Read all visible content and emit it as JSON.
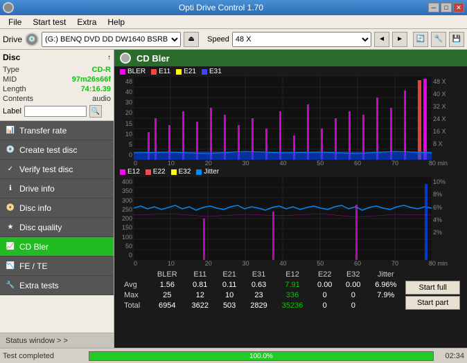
{
  "titlebar": {
    "title": "Opti Drive Control 1.70",
    "icon": "disc",
    "minimize": "─",
    "maximize": "□",
    "close": "✕"
  },
  "menubar": {
    "items": [
      "File",
      "Start test",
      "Extra",
      "Help"
    ]
  },
  "drivebar": {
    "label": "Drive",
    "drive_value": "(G:)  BENQ DVD DD DW1640 BSRB",
    "speed_label": "Speed",
    "speed_value": "48 X"
  },
  "disc": {
    "header": "Disc",
    "type_label": "Type",
    "type_value": "CD-R",
    "mid_label": "MID",
    "mid_value": "97m26s66f",
    "length_label": "Length",
    "length_value": "74:16.39",
    "contents_label": "Contents",
    "contents_value": "audio",
    "label_label": "Label",
    "label_value": ""
  },
  "nav": {
    "items": [
      {
        "id": "transfer-rate",
        "label": "Transfer rate",
        "icon": "📊"
      },
      {
        "id": "create-test-disc",
        "label": "Create test disc",
        "icon": "💿"
      },
      {
        "id": "verify-test-disc",
        "label": "Verify test disc",
        "icon": "✓"
      },
      {
        "id": "drive-info",
        "label": "Drive info",
        "icon": "ℹ"
      },
      {
        "id": "disc-info",
        "label": "Disc info",
        "icon": "📀"
      },
      {
        "id": "disc-quality",
        "label": "Disc quality",
        "icon": "★"
      },
      {
        "id": "cd-bler",
        "label": "CD Bler",
        "icon": "📈",
        "active": true
      },
      {
        "id": "fe-te",
        "label": "FE / TE",
        "icon": "📉"
      },
      {
        "id": "extra-tests",
        "label": "Extra tests",
        "icon": "🔧"
      }
    ]
  },
  "chart": {
    "title": "CD Bler",
    "top_legend": [
      "BLER",
      "E11",
      "E21",
      "E31"
    ],
    "top_legend_colors": [
      "#ff00ff",
      "#ff0000",
      "#ffff00",
      "#0000ff"
    ],
    "bottom_legend": [
      "E12",
      "E22",
      "E32",
      "Jitter"
    ],
    "bottom_legend_colors": [
      "#ff00ff",
      "#ff0000",
      "#ffff00",
      "#0088ff"
    ],
    "top_y_labels": [
      "48 X",
      "40 X",
      "32 X",
      "24 X",
      "16 X",
      "8 X"
    ],
    "bottom_y_labels": [
      "10%",
      "8%",
      "6%",
      "4%",
      "2%"
    ],
    "x_labels": [
      "0",
      "10",
      "20",
      "30",
      "40",
      "50",
      "60",
      "70",
      "80 min"
    ],
    "top_y_axis": [
      "48",
      "40",
      "30",
      "20",
      "15",
      "10",
      "5",
      "0"
    ],
    "bottom_y_axis": [
      "400",
      "350",
      "300",
      "250",
      "200",
      "150",
      "100",
      "50",
      "0"
    ]
  },
  "stats": {
    "columns": [
      "BLER",
      "E11",
      "E21",
      "E31",
      "E12",
      "E22",
      "E32",
      "Jitter"
    ],
    "rows": [
      {
        "label": "Avg",
        "values": [
          "1.56",
          "0.81",
          "0.11",
          "0.63",
          "7.91",
          "0.00",
          "0.00",
          "6.96%"
        ]
      },
      {
        "label": "Max",
        "values": [
          "25",
          "12",
          "10",
          "23",
          "336",
          "0",
          "0",
          "7.9%"
        ]
      },
      {
        "label": "Total",
        "values": [
          "6954",
          "3622",
          "503",
          "2829",
          "35236",
          "0",
          "0",
          ""
        ]
      }
    ],
    "start_full": "Start full",
    "start_part": "Start part"
  },
  "statusbar": {
    "text": "Test completed",
    "progress": 100.0,
    "progress_text": "100.0%",
    "time": "02:34"
  },
  "status_window": {
    "label": "Status window > >"
  }
}
